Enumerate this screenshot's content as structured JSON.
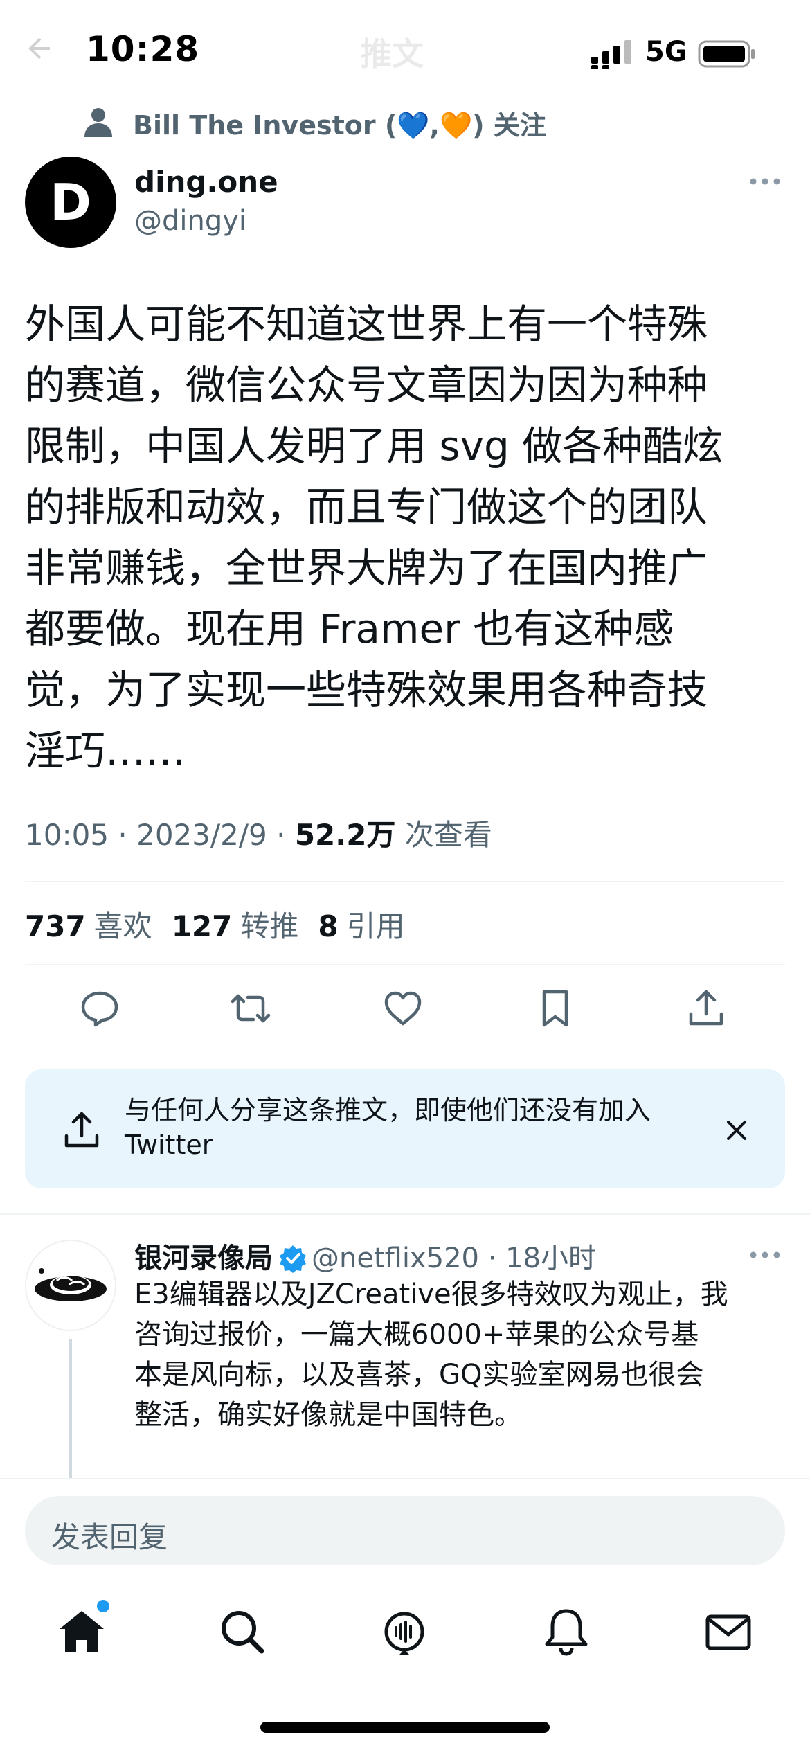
{
  "status_bar": {
    "time": "10:28",
    "network": "5G",
    "faded_title": "推文"
  },
  "social_context": {
    "text": "Bill The Investor (💙,🧡) 关注"
  },
  "tweet": {
    "author_name": "ding.one",
    "author_handle": "@dingyi",
    "avatar_letter": "D",
    "text_lines": [
      "外国人可能不知道这世界上有一个特殊",
      "的赛道，微信公众号文章因为因为种种",
      "限制，中国人发明了用 svg 做各种酷炫",
      "的排版和动效，而且专门做这个的团队",
      "非常赚钱，全世界大牌为了在国内推广",
      "都要做。现在用 Framer 也有这种感",
      "觉，为了实现一些特殊效果用各种奇技",
      "淫巧……"
    ],
    "time": "10:05",
    "date": "2023/2/9",
    "views": "52.2万",
    "views_label": "次查看",
    "likes": "737",
    "likes_label": "喜欢",
    "retweets": "127",
    "retweets_label": "转推",
    "quotes": "8",
    "quotes_label": "引用"
  },
  "share_banner": {
    "text": "与任何人分享这条推文，即使他们还没有加入 Twitter"
  },
  "reply": {
    "name": "银河录像局",
    "handle": "@netflix520",
    "time": "18小时",
    "text_lines": [
      "E3编辑器以及JZCreative很多特效叹为观止，我",
      "咨询过报价，一篇大概6000+苹果的公众号基",
      "本是风向标，以及喜茶，GQ实验室网易也很会",
      "整活，确实好像就是中国特色。"
    ]
  },
  "compose": {
    "placeholder": "发表回复"
  },
  "colors": {
    "accent": "#1d9bf0",
    "muted": "#536471",
    "banner_bg": "#e8f5fd"
  }
}
